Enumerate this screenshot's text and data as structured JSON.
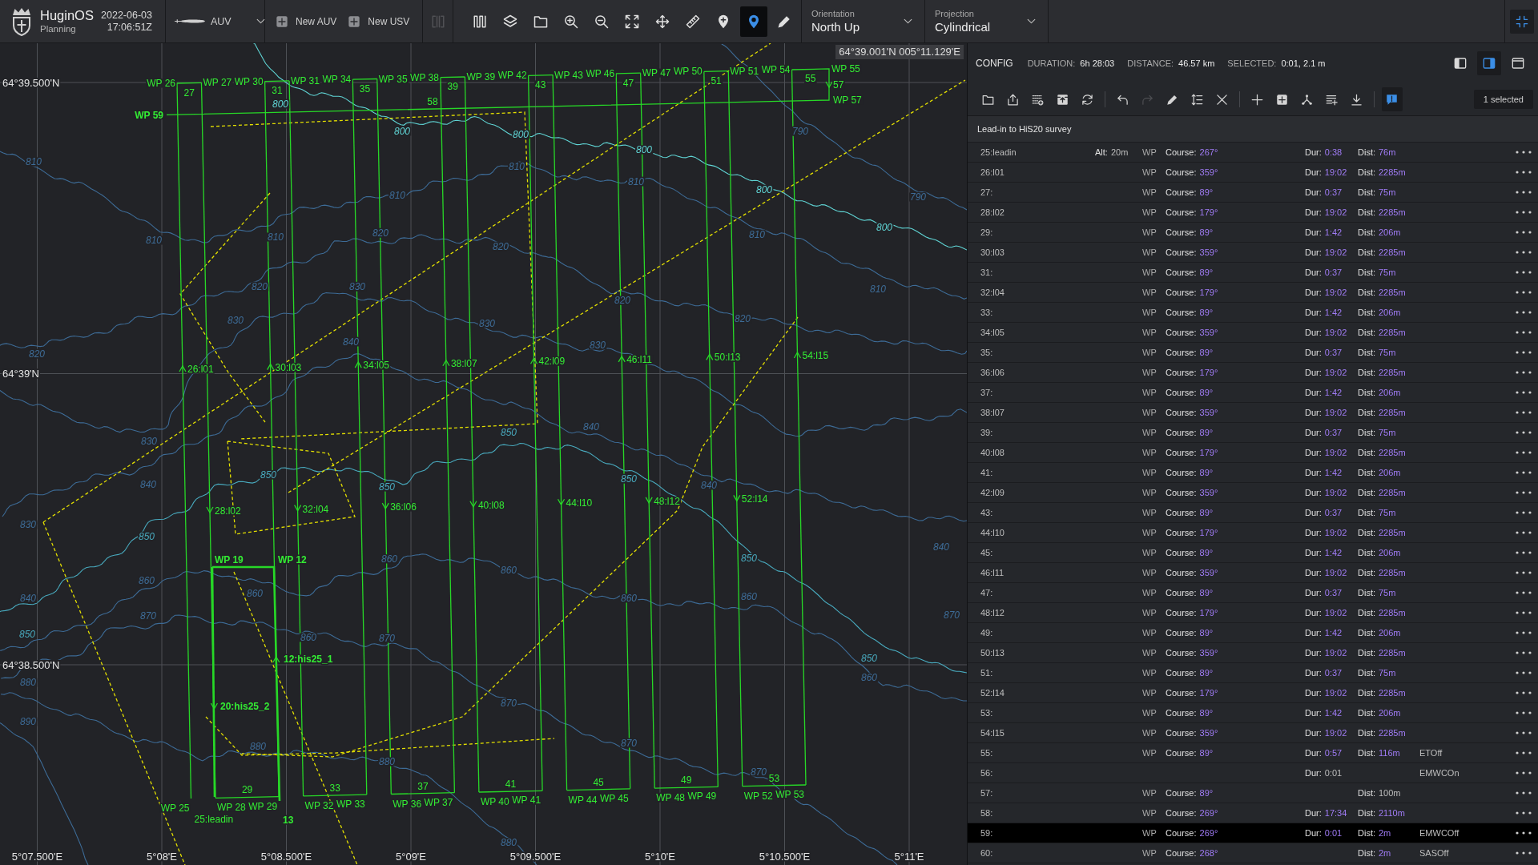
{
  "toolbar": {
    "brand": {
      "name": "HuginOS",
      "mode": "Planning"
    },
    "clock": {
      "date": "2022-06-03",
      "time": "17:06:51Z"
    },
    "vehicle": {
      "label": "AUV"
    },
    "new_buttons": [
      {
        "label": "New AUV"
      },
      {
        "label": "New USV"
      }
    ],
    "tool_groups": [
      [
        {
          "kind": "columns",
          "selected": false,
          "disabled": true
        }
      ],
      [
        {
          "kind": "pattern",
          "selected": false,
          "disabled": false
        },
        {
          "kind": "layers",
          "selected": false,
          "disabled": false
        },
        {
          "kind": "folder",
          "selected": false,
          "disabled": false
        },
        {
          "kind": "zoom_in",
          "selected": false,
          "disabled": false
        },
        {
          "kind": "zoom_out",
          "selected": false,
          "disabled": false
        },
        {
          "kind": "fit",
          "selected": false,
          "disabled": false
        },
        {
          "kind": "move",
          "selected": false,
          "disabled": false
        },
        {
          "kind": "ruler",
          "selected": false,
          "disabled": false
        },
        {
          "kind": "pin_add",
          "selected": false,
          "disabled": false
        },
        {
          "kind": "pin",
          "selected": true,
          "disabled": false
        },
        {
          "kind": "pencil",
          "selected": false,
          "disabled": false
        }
      ]
    ],
    "dropdowns": [
      {
        "label": "Orientation",
        "value": "North Up"
      },
      {
        "label": "Projection",
        "value": "Cylindrical"
      }
    ],
    "corner_button": {
      "kind": "collapse"
    }
  },
  "map": {
    "readout": "64°39.001'N 005°11.129'E",
    "latitude_labels": [
      "64°39.500'N",
      "64°39'N",
      "64°38.500'N"
    ],
    "longitude_labels": [
      "5°07.500'E",
      "5°08'E",
      "5°08.500'E",
      "5°09'E",
      "5°09.500'E",
      "5°10'E",
      "5°10.500'E",
      "5°11'E"
    ],
    "lanes": [
      {
        "label": "26:l01",
        "kind": "up"
      },
      {
        "label": "28:l02",
        "kind": "down"
      },
      {
        "label": "30:l03",
        "kind": "up"
      },
      {
        "label": "32:l04",
        "kind": "down"
      },
      {
        "label": "34:l05",
        "kind": "up"
      },
      {
        "label": "36:l06",
        "kind": "down"
      },
      {
        "label": "38:l07",
        "kind": "up"
      },
      {
        "label": "40:l08",
        "kind": "down"
      },
      {
        "label": "42:l09",
        "kind": "up"
      },
      {
        "label": "44:l10",
        "kind": "down"
      },
      {
        "label": "46:l11",
        "kind": "up"
      },
      {
        "label": "48:l12",
        "kind": "down"
      },
      {
        "label": "50:l13",
        "kind": "up"
      },
      {
        "label": "52:l14",
        "kind": "down"
      },
      {
        "label": "54:l15",
        "kind": "up"
      }
    ],
    "top_waypoints": [
      "WP 26",
      "WP 27",
      "WP 30",
      "WP 31",
      "WP 34",
      "WP 35",
      "WP 38",
      "WP 39",
      "WP 42",
      "WP 43",
      "WP 46",
      "WP 47",
      "WP 50",
      "WP 51",
      "WP 54",
      "WP 55"
    ],
    "bottom_waypoints": [
      "WP 25",
      "WP 28",
      "WP 29",
      "WP 32",
      "WP 33",
      "WP 36",
      "WP 37",
      "WP 40",
      "WP 41",
      "WP 44",
      "WP 45",
      "WP 48",
      "WP 49",
      "WP 52",
      "WP 53"
    ],
    "top_legs": [
      "27",
      "31",
      "35",
      "39",
      "43",
      "47",
      "51",
      "55"
    ],
    "bottom_legs": [
      "25:leadin",
      "29",
      "33",
      "37",
      "41",
      "45",
      "49",
      "53"
    ],
    "extra_labels": [
      {
        "text": "57",
        "bold": false
      },
      {
        "text": "WP 57",
        "bold": false
      },
      {
        "text": "58",
        "bold": false
      },
      {
        "text": "WP 59",
        "bold": true
      },
      {
        "text": "WP 19",
        "bold": true
      },
      {
        "text": "WP 12",
        "bold": true
      },
      {
        "text": "12:his25_1",
        "bold": true
      },
      {
        "text": "20:his25_2",
        "bold": true
      },
      {
        "text": "13",
        "bold": true
      }
    ],
    "depth_labels": [
      {
        "text": "800",
        "color": "#5fd3d3"
      },
      {
        "text": "800",
        "color": "#5fd3d3"
      },
      {
        "text": "800",
        "color": "#5fd3d3"
      },
      {
        "text": "800",
        "color": "#5fd3d3"
      },
      {
        "text": "800",
        "color": "#5fd3d3"
      },
      {
        "text": "800",
        "color": "#5fd3d3"
      },
      {
        "text": "790",
        "color": "#3d6b96"
      },
      {
        "text": "790",
        "color": "#3d6b96"
      },
      {
        "text": "810",
        "color": "#3d6b96"
      },
      {
        "text": "810",
        "color": "#3d6b96"
      },
      {
        "text": "810",
        "color": "#3d6b96"
      },
      {
        "text": "810",
        "color": "#3d6b96"
      },
      {
        "text": "810",
        "color": "#3d6b96"
      },
      {
        "text": "810",
        "color": "#3d6b96"
      },
      {
        "text": "810",
        "color": "#3d6b96"
      },
      {
        "text": "810",
        "color": "#3d6b96"
      },
      {
        "text": "820",
        "color": "#3d6b96"
      },
      {
        "text": "820",
        "color": "#3d6b96"
      },
      {
        "text": "820",
        "color": "#3d6b96"
      },
      {
        "text": "820",
        "color": "#3d6b96"
      },
      {
        "text": "820",
        "color": "#3d6b96"
      },
      {
        "text": "820",
        "color": "#3d6b96"
      },
      {
        "text": "830",
        "color": "#3d6b96"
      },
      {
        "text": "830",
        "color": "#3d6b96"
      },
      {
        "text": "830",
        "color": "#3d6b96"
      },
      {
        "text": "830",
        "color": "#3d6b96"
      },
      {
        "text": "830",
        "color": "#3d6b96"
      },
      {
        "text": "830",
        "color": "#3d6b96"
      },
      {
        "text": "840",
        "color": "#3d6b96"
      },
      {
        "text": "840",
        "color": "#3d6b96"
      },
      {
        "text": "840",
        "color": "#3d6b96"
      },
      {
        "text": "840",
        "color": "#3d6b96"
      },
      {
        "text": "840",
        "color": "#3d6b96"
      },
      {
        "text": "840",
        "color": "#3d6b96"
      },
      {
        "text": "850",
        "color": "#48a9bd"
      },
      {
        "text": "850",
        "color": "#48a9bd"
      },
      {
        "text": "850",
        "color": "#48a9bd"
      },
      {
        "text": "850",
        "color": "#48a9bd"
      },
      {
        "text": "850",
        "color": "#48a9bd"
      },
      {
        "text": "850",
        "color": "#48a9bd"
      },
      {
        "text": "850",
        "color": "#48a9bd"
      },
      {
        "text": "850",
        "color": "#48a9bd"
      },
      {
        "text": "860",
        "color": "#3d6b96"
      },
      {
        "text": "860",
        "color": "#3d6b96"
      },
      {
        "text": "860",
        "color": "#3d6b96"
      },
      {
        "text": "860",
        "color": "#3d6b96"
      },
      {
        "text": "860",
        "color": "#3d6b96"
      },
      {
        "text": "860",
        "color": "#3d6b96"
      },
      {
        "text": "860",
        "color": "#3d6b96"
      },
      {
        "text": "860",
        "color": "#3d6b96"
      },
      {
        "text": "870",
        "color": "#3d6b96"
      },
      {
        "text": "870",
        "color": "#3d6b96"
      },
      {
        "text": "870",
        "color": "#3d6b96"
      },
      {
        "text": "870",
        "color": "#3d6b96"
      },
      {
        "text": "870",
        "color": "#3d6b96"
      },
      {
        "text": "870",
        "color": "#3d6b96"
      },
      {
        "text": "880",
        "color": "#3d6b96"
      },
      {
        "text": "880",
        "color": "#3d6b96"
      },
      {
        "text": "880",
        "color": "#3d6b96"
      },
      {
        "text": "880",
        "color": "#3d6b96"
      },
      {
        "text": "890",
        "color": "#3d6b96"
      }
    ]
  },
  "panel": {
    "title": "CONFIG",
    "stats": [
      {
        "label": "DURATION:",
        "value": "6h 28:03"
      },
      {
        "label": "DISTANCE:",
        "value": "46.57 km"
      },
      {
        "label": "SELECTED:",
        "value": "0:01, 2.1 m"
      }
    ],
    "layouts": [
      {
        "kind": "dock_left",
        "selected": false
      },
      {
        "kind": "dock_right",
        "selected": true
      },
      {
        "kind": "float",
        "selected": false
      }
    ],
    "action_groups": [
      [
        {
          "kind": "folder",
          "selected": false,
          "disabled": false
        },
        {
          "kind": "export",
          "selected": false,
          "disabled": false
        },
        {
          "kind": "grid_add",
          "selected": false,
          "disabled": false
        },
        {
          "kind": "archive",
          "selected": false,
          "disabled": false
        },
        {
          "kind": "sync",
          "selected": false,
          "disabled": false
        }
      ],
      [
        {
          "kind": "undo",
          "selected": false,
          "disabled": false
        },
        {
          "kind": "redo",
          "selected": false,
          "disabled": true
        },
        {
          "kind": "edit",
          "selected": false,
          "disabled": false
        },
        {
          "kind": "sort",
          "selected": false,
          "disabled": false
        },
        {
          "kind": "delete",
          "selected": false,
          "disabled": false
        }
      ],
      [
        {
          "kind": "add",
          "selected": false,
          "disabled": false
        },
        {
          "kind": "insert",
          "selected": false,
          "disabled": false
        },
        {
          "kind": "fork",
          "selected": false,
          "disabled": false
        },
        {
          "kind": "list_add",
          "selected": false,
          "disabled": false
        },
        {
          "kind": "download",
          "selected": false,
          "disabled": false
        }
      ],
      [
        {
          "kind": "comment",
          "selected": true,
          "disabled": false
        }
      ]
    ],
    "selection": "1 selected",
    "group_title": "Lead-in to HiS20 survey",
    "rows": [
      {
        "label": "25:leadin",
        "alt": {
          "label": "Alt:",
          "value": "20m",
          "computed": false
        },
        "type": "WP",
        "course": {
          "label": "Course:",
          "value": "267°",
          "computed": true
        },
        "dur": {
          "label": "Dur:",
          "value": "0:38",
          "computed": true
        },
        "dist": {
          "label": "Dist:",
          "value": "76m",
          "computed": true
        },
        "selected": false
      },
      {
        "label": "26:l01",
        "type": "WP",
        "course": {
          "label": "Course:",
          "value": "359°",
          "computed": true
        },
        "dur": {
          "label": "Dur:",
          "value": "19:02",
          "computed": true
        },
        "dist": {
          "label": "Dist:",
          "value": "2285m",
          "computed": true
        },
        "selected": false
      },
      {
        "label": "27:",
        "type": "WP",
        "course": {
          "label": "Course:",
          "value": "89°",
          "computed": true
        },
        "dur": {
          "label": "Dur:",
          "value": "0:37",
          "computed": true
        },
        "dist": {
          "label": "Dist:",
          "value": "75m",
          "computed": true
        },
        "selected": false
      },
      {
        "label": "28:l02",
        "type": "WP",
        "course": {
          "label": "Course:",
          "value": "179°",
          "computed": true
        },
        "dur": {
          "label": "Dur:",
          "value": "19:02",
          "computed": true
        },
        "dist": {
          "label": "Dist:",
          "value": "2285m",
          "computed": true
        },
        "selected": false
      },
      {
        "label": "29:",
        "type": "WP",
        "course": {
          "label": "Course:",
          "value": "89°",
          "computed": true
        },
        "dur": {
          "label": "Dur:",
          "value": "1:42",
          "computed": true
        },
        "dist": {
          "label": "Dist:",
          "value": "206m",
          "computed": true
        },
        "selected": false
      },
      {
        "label": "30:l03",
        "type": "WP",
        "course": {
          "label": "Course:",
          "value": "359°",
          "computed": true
        },
        "dur": {
          "label": "Dur:",
          "value": "19:02",
          "computed": true
        },
        "dist": {
          "label": "Dist:",
          "value": "2285m",
          "computed": true
        },
        "selected": false
      },
      {
        "label": "31:",
        "type": "WP",
        "course": {
          "label": "Course:",
          "value": "89°",
          "computed": true
        },
        "dur": {
          "label": "Dur:",
          "value": "0:37",
          "computed": true
        },
        "dist": {
          "label": "Dist:",
          "value": "75m",
          "computed": true
        },
        "selected": false
      },
      {
        "label": "32:l04",
        "type": "WP",
        "course": {
          "label": "Course:",
          "value": "179°",
          "computed": true
        },
        "dur": {
          "label": "Dur:",
          "value": "19:02",
          "computed": true
        },
        "dist": {
          "label": "Dist:",
          "value": "2285m",
          "computed": true
        },
        "selected": false
      },
      {
        "label": "33:",
        "type": "WP",
        "course": {
          "label": "Course:",
          "value": "89°",
          "computed": true
        },
        "dur": {
          "label": "Dur:",
          "value": "1:42",
          "computed": true
        },
        "dist": {
          "label": "Dist:",
          "value": "206m",
          "computed": true
        },
        "selected": false
      },
      {
        "label": "34:l05",
        "type": "WP",
        "course": {
          "label": "Course:",
          "value": "359°",
          "computed": true
        },
        "dur": {
          "label": "Dur:",
          "value": "19:02",
          "computed": true
        },
        "dist": {
          "label": "Dist:",
          "value": "2285m",
          "computed": true
        },
        "selected": false
      },
      {
        "label": "35:",
        "type": "WP",
        "course": {
          "label": "Course:",
          "value": "89°",
          "computed": true
        },
        "dur": {
          "label": "Dur:",
          "value": "0:37",
          "computed": true
        },
        "dist": {
          "label": "Dist:",
          "value": "75m",
          "computed": true
        },
        "selected": false
      },
      {
        "label": "36:l06",
        "type": "WP",
        "course": {
          "label": "Course:",
          "value": "179°",
          "computed": true
        },
        "dur": {
          "label": "Dur:",
          "value": "19:02",
          "computed": true
        },
        "dist": {
          "label": "Dist:",
          "value": "2285m",
          "computed": true
        },
        "selected": false
      },
      {
        "label": "37:",
        "type": "WP",
        "course": {
          "label": "Course:",
          "value": "89°",
          "computed": true
        },
        "dur": {
          "label": "Dur:",
          "value": "1:42",
          "computed": true
        },
        "dist": {
          "label": "Dist:",
          "value": "206m",
          "computed": true
        },
        "selected": false
      },
      {
        "label": "38:l07",
        "type": "WP",
        "course": {
          "label": "Course:",
          "value": "359°",
          "computed": true
        },
        "dur": {
          "label": "Dur:",
          "value": "19:02",
          "computed": true
        },
        "dist": {
          "label": "Dist:",
          "value": "2285m",
          "computed": true
        },
        "selected": false
      },
      {
        "label": "39:",
        "type": "WP",
        "course": {
          "label": "Course:",
          "value": "89°",
          "computed": true
        },
        "dur": {
          "label": "Dur:",
          "value": "0:37",
          "computed": true
        },
        "dist": {
          "label": "Dist:",
          "value": "75m",
          "computed": true
        },
        "selected": false
      },
      {
        "label": "40:l08",
        "type": "WP",
        "course": {
          "label": "Course:",
          "value": "179°",
          "computed": true
        },
        "dur": {
          "label": "Dur:",
          "value": "19:02",
          "computed": true
        },
        "dist": {
          "label": "Dist:",
          "value": "2285m",
          "computed": true
        },
        "selected": false
      },
      {
        "label": "41:",
        "type": "WP",
        "course": {
          "label": "Course:",
          "value": "89°",
          "computed": true
        },
        "dur": {
          "label": "Dur:",
          "value": "1:42",
          "computed": true
        },
        "dist": {
          "label": "Dist:",
          "value": "206m",
          "computed": true
        },
        "selected": false
      },
      {
        "label": "42:l09",
        "type": "WP",
        "course": {
          "label": "Course:",
          "value": "359°",
          "computed": true
        },
        "dur": {
          "label": "Dur:",
          "value": "19:02",
          "computed": true
        },
        "dist": {
          "label": "Dist:",
          "value": "2285m",
          "computed": true
        },
        "selected": false
      },
      {
        "label": "43:",
        "type": "WP",
        "course": {
          "label": "Course:",
          "value": "89°",
          "computed": true
        },
        "dur": {
          "label": "Dur:",
          "value": "0:37",
          "computed": true
        },
        "dist": {
          "label": "Dist:",
          "value": "75m",
          "computed": true
        },
        "selected": false
      },
      {
        "label": "44:l10",
        "type": "WP",
        "course": {
          "label": "Course:",
          "value": "179°",
          "computed": true
        },
        "dur": {
          "label": "Dur:",
          "value": "19:02",
          "computed": true
        },
        "dist": {
          "label": "Dist:",
          "value": "2285m",
          "computed": true
        },
        "selected": false
      },
      {
        "label": "45:",
        "type": "WP",
        "course": {
          "label": "Course:",
          "value": "89°",
          "computed": true
        },
        "dur": {
          "label": "Dur:",
          "value": "1:42",
          "computed": true
        },
        "dist": {
          "label": "Dist:",
          "value": "206m",
          "computed": true
        },
        "selected": false
      },
      {
        "label": "46:l11",
        "type": "WP",
        "course": {
          "label": "Course:",
          "value": "359°",
          "computed": true
        },
        "dur": {
          "label": "Dur:",
          "value": "19:02",
          "computed": true
        },
        "dist": {
          "label": "Dist:",
          "value": "2285m",
          "computed": true
        },
        "selected": false
      },
      {
        "label": "47:",
        "type": "WP",
        "course": {
          "label": "Course:",
          "value": "89°",
          "computed": true
        },
        "dur": {
          "label": "Dur:",
          "value": "0:37",
          "computed": true
        },
        "dist": {
          "label": "Dist:",
          "value": "75m",
          "computed": true
        },
        "selected": false
      },
      {
        "label": "48:l12",
        "type": "WP",
        "course": {
          "label": "Course:",
          "value": "179°",
          "computed": true
        },
        "dur": {
          "label": "Dur:",
          "value": "19:02",
          "computed": true
        },
        "dist": {
          "label": "Dist:",
          "value": "2285m",
          "computed": true
        },
        "selected": false
      },
      {
        "label": "49:",
        "type": "WP",
        "course": {
          "label": "Course:",
          "value": "89°",
          "computed": true
        },
        "dur": {
          "label": "Dur:",
          "value": "1:42",
          "computed": true
        },
        "dist": {
          "label": "Dist:",
          "value": "206m",
          "computed": true
        },
        "selected": false
      },
      {
        "label": "50:l13",
        "type": "WP",
        "course": {
          "label": "Course:",
          "value": "359°",
          "computed": true
        },
        "dur": {
          "label": "Dur:",
          "value": "19:02",
          "computed": true
        },
        "dist": {
          "label": "Dist:",
          "value": "2285m",
          "computed": true
        },
        "selected": false
      },
      {
        "label": "51:",
        "type": "WP",
        "course": {
          "label": "Course:",
          "value": "89°",
          "computed": true
        },
        "dur": {
          "label": "Dur:",
          "value": "0:37",
          "computed": true
        },
        "dist": {
          "label": "Dist:",
          "value": "75m",
          "computed": true
        },
        "selected": false
      },
      {
        "label": "52:l14",
        "type": "WP",
        "course": {
          "label": "Course:",
          "value": "179°",
          "computed": true
        },
        "dur": {
          "label": "Dur:",
          "value": "19:02",
          "computed": true
        },
        "dist": {
          "label": "Dist:",
          "value": "2285m",
          "computed": true
        },
        "selected": false
      },
      {
        "label": "53:",
        "type": "WP",
        "course": {
          "label": "Course:",
          "value": "89°",
          "computed": true
        },
        "dur": {
          "label": "Dur:",
          "value": "1:42",
          "computed": true
        },
        "dist": {
          "label": "Dist:",
          "value": "206m",
          "computed": true
        },
        "selected": false
      },
      {
        "label": "54:l15",
        "type": "WP",
        "course": {
          "label": "Course:",
          "value": "359°",
          "computed": true
        },
        "dur": {
          "label": "Dur:",
          "value": "19:02",
          "computed": true
        },
        "dist": {
          "label": "Dist:",
          "value": "2285m",
          "computed": true
        },
        "selected": false
      },
      {
        "label": "55:",
        "type": "WP",
        "course": {
          "label": "Course:",
          "value": "89°",
          "computed": true
        },
        "dur": {
          "label": "Dur:",
          "value": "0:57",
          "computed": true
        },
        "dist": {
          "label": "Dist:",
          "value": "116m",
          "computed": true
        },
        "event": "ETOff",
        "selected": false
      },
      {
        "label": "56:",
        "dur": {
          "label": "Dur:",
          "value": "0:01",
          "computed": false
        },
        "event": "EMWCOn",
        "selected": false
      },
      {
        "label": "57:",
        "type": "WP",
        "course": {
          "label": "Course:",
          "value": "89°",
          "computed": true
        },
        "dist": {
          "label": "Dist:",
          "value": "100m",
          "computed": false
        },
        "selected": false
      },
      {
        "label": "58:",
        "type": "WP",
        "course": {
          "label": "Course:",
          "value": "269°",
          "computed": true
        },
        "dur": {
          "label": "Dur:",
          "value": "17:34",
          "computed": true
        },
        "dist": {
          "label": "Dist:",
          "value": "2110m",
          "computed": true
        },
        "selected": false
      },
      {
        "label": "59:",
        "type": "WP",
        "course": {
          "label": "Course:",
          "value": "269°",
          "computed": true
        },
        "dur": {
          "label": "Dur:",
          "value": "0:01",
          "computed": true
        },
        "dist": {
          "label": "Dist:",
          "value": "2m",
          "computed": true
        },
        "event": "EMWCOff",
        "selected": true
      },
      {
        "label": "60:",
        "type": "WP",
        "course": {
          "label": "Course:",
          "value": "268°",
          "computed": true
        },
        "dist": {
          "label": "Dist:",
          "value": "2m",
          "computed": true
        },
        "event": "SASOff",
        "selected": false
      }
    ]
  }
}
